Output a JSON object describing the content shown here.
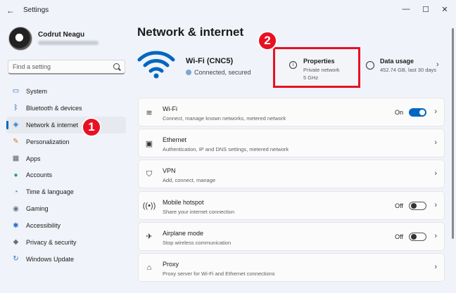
{
  "window": {
    "title": "Settings",
    "back_icon": "back-arrow-icon",
    "minimize_glyph": "—",
    "maximize_glyph": "☐",
    "close_glyph": "✕"
  },
  "user": {
    "name": "Codrut Neagu"
  },
  "search": {
    "placeholder": "Find a setting"
  },
  "sidebar": {
    "items": [
      {
        "label": "System",
        "icon": "monitor-icon",
        "glyph": "▭",
        "color": "#1f6fd1",
        "active": false
      },
      {
        "label": "Bluetooth & devices",
        "icon": "bluetooth-icon",
        "glyph": "ᛒ",
        "color": "#0f5aa8",
        "active": false
      },
      {
        "label": "Network & internet",
        "icon": "wifi-icon",
        "glyph": "◈",
        "color": "#1f7bd6",
        "active": true
      },
      {
        "label": "Personalization",
        "icon": "brush-icon",
        "glyph": "✎",
        "color": "#d9712f",
        "active": false
      },
      {
        "label": "Apps",
        "icon": "apps-icon",
        "glyph": "▦",
        "color": "#59606d",
        "active": false
      },
      {
        "label": "Accounts",
        "icon": "person-icon",
        "glyph": "●",
        "color": "#2aa06b",
        "active": false
      },
      {
        "label": "Time & language",
        "icon": "globe-clock-icon",
        "glyph": "◔",
        "color": "#1b86c9",
        "active": false
      },
      {
        "label": "Gaming",
        "icon": "gamepad-icon",
        "glyph": "◉",
        "color": "#6c7380",
        "active": false
      },
      {
        "label": "Accessibility",
        "icon": "accessibility-icon",
        "glyph": "✱",
        "color": "#1c6fd0",
        "active": false
      },
      {
        "label": "Privacy & security",
        "icon": "shield-icon",
        "glyph": "◆",
        "color": "#67707c",
        "active": false
      },
      {
        "label": "Windows Update",
        "icon": "update-icon",
        "glyph": "↻",
        "color": "#1d74cc",
        "active": false
      }
    ]
  },
  "callouts": {
    "one": "1",
    "two": "2",
    "color": "#e81123"
  },
  "main": {
    "title": "Network & internet",
    "wifi": {
      "name": "Wi-Fi (CNC5)",
      "status": "Connected, secured"
    },
    "properties": {
      "title": "Properties",
      "line1": "Private network",
      "line2": "5 GHz"
    },
    "data_usage": {
      "title": "Data usage",
      "sub": "452.74 GB, last 30 days"
    },
    "rows": [
      {
        "title": "Wi-Fi",
        "sub": "Connect, manage known networks, metered network",
        "icon": "wifi-icon",
        "glyph": "≋",
        "toggle": "On",
        "toggle_on": true
      },
      {
        "title": "Ethernet",
        "sub": "Authentication, IP and DNS settings, metered network",
        "icon": "ethernet-icon",
        "glyph": "▣",
        "toggle": null,
        "toggle_on": null
      },
      {
        "title": "VPN",
        "sub": "Add, connect, manage",
        "icon": "vpn-shield-icon",
        "glyph": "⛉",
        "toggle": null,
        "toggle_on": null
      },
      {
        "title": "Mobile hotspot",
        "sub": "Share your internet connection",
        "icon": "hotspot-icon",
        "glyph": "((•))",
        "toggle": "Off",
        "toggle_on": false
      },
      {
        "title": "Airplane mode",
        "sub": "Stop wireless communication",
        "icon": "airplane-icon",
        "glyph": "✈",
        "toggle": "Off",
        "toggle_on": false
      },
      {
        "title": "Proxy",
        "sub": "Proxy server for Wi-Fi and Ethernet connections",
        "icon": "proxy-icon",
        "glyph": "⌂",
        "toggle": null,
        "toggle_on": null
      }
    ]
  },
  "colors": {
    "accent": "#0067c0",
    "background": "#f0f3f9"
  }
}
